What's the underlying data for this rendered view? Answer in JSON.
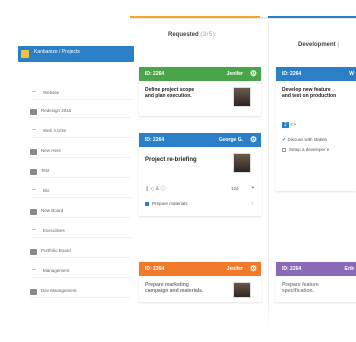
{
  "sidebar": {
    "header": "Kanbanize / Projects",
    "items": [
      {
        "label": "Website",
        "icon": "minus-icon"
      },
      {
        "label": "Redesign 2015",
        "icon": "board-icon"
      },
      {
        "label": "Web 4.0/15",
        "icon": "minus-icon"
      },
      {
        "label": "New Here",
        "icon": "board-icon"
      },
      {
        "label": "Test",
        "icon": "board-icon"
      },
      {
        "label": "Bio",
        "icon": "minus-icon"
      },
      {
        "label": "New Board",
        "icon": "board-icon"
      },
      {
        "label": "Executives",
        "icon": "minus-icon"
      },
      {
        "label": "Portfolio Board",
        "icon": "board-icon"
      },
      {
        "label": "Management",
        "icon": "minus-icon"
      },
      {
        "label": "Dev Management",
        "icon": "board-icon"
      }
    ]
  },
  "columns": [
    {
      "title": "Requested",
      "count": "(3/5)"
    },
    {
      "title": "Development",
      "count": "("
    }
  ],
  "cards": {
    "c1": {
      "id": "ID: 2264",
      "user": "Jenifer",
      "text1": "Define project scope",
      "text2": "and plan execution."
    },
    "c2": {
      "id": "ID: 2264",
      "user": "George G.",
      "text1": "Project re-briefing",
      "footer_icons": "❙ ◇ & ⓘ",
      "footer_num": "12d",
      "task": "Prepare materials"
    },
    "c3": {
      "id": "ID: 2264",
      "user": "Jenifer",
      "text1": "Prepare marketing",
      "text2": "campaign and materials."
    },
    "d1": {
      "id": "ID: 2264",
      "user": "W",
      "text1": "Develop new feature",
      "text2": "and test on production",
      "badge": "2",
      "task1": "Discuss with stakeh",
      "task2": "Setup a developer e"
    },
    "d2": {
      "id": "ID: 2264",
      "user": "Erik",
      "text1": "Prepare feature",
      "text2": "specification."
    }
  },
  "colors": {
    "green": "#4aa54a",
    "blue": "#2a7fc6",
    "orange": "#f07a2a",
    "purple": "#8a6ab8",
    "accent": "#f5a623"
  }
}
